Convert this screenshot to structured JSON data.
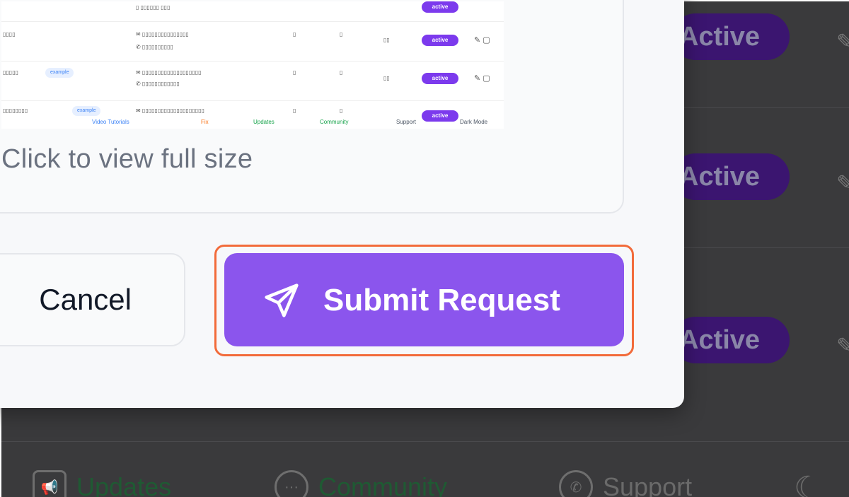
{
  "background": {
    "badges": [
      "Active",
      "Active",
      "Active"
    ],
    "footer": {
      "updates": "Updates",
      "community": "Community",
      "support": "Support"
    }
  },
  "modal": {
    "preview": {
      "caption": "Click to view full size",
      "thumbnail": {
        "status_pill": "active",
        "tag": "example",
        "toolbar": [
          "Video Tutorials",
          "Fix",
          "Updates",
          "Community",
          "Support",
          "Dark Mode"
        ]
      }
    },
    "cancel_label": "Cancel",
    "submit_label": "Submit Request",
    "colors": {
      "accent": "#8b55ed",
      "highlight": "#f26b3a"
    }
  }
}
